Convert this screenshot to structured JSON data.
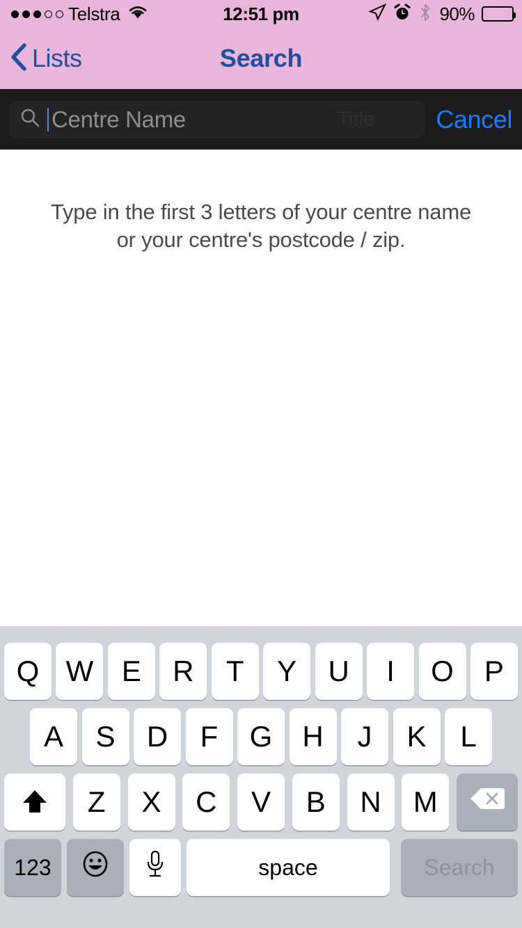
{
  "status_bar": {
    "carrier": "Telstra",
    "signal_dots_filled": 3,
    "signal_dots_total": 5,
    "wifi_icon": "wifi-icon",
    "time": "12:51 pm",
    "location_icon": "location-arrow-icon",
    "alarm_icon": "alarm-clock-icon",
    "bluetooth_icon": "bluetooth-icon",
    "battery_percent": "90%",
    "battery_level": 90
  },
  "nav_bar": {
    "back_label": "Lists",
    "back_icon": "chevron-left-icon",
    "title": "Search",
    "background_color": "#eab5da",
    "tint_color": "#1e4fa0"
  },
  "search_bar": {
    "search_icon": "search-icon",
    "placeholder": "Centre Name",
    "value": "",
    "ghost_text": "Title",
    "cancel_label": "Cancel",
    "cancel_color": "#1a7bff",
    "field_background": "#242424",
    "bar_background": "#1c1c1c"
  },
  "content": {
    "hint_line_1": "Type in the first 3 letters of your centre name",
    "hint_line_2": "or your centre's postcode / zip."
  },
  "keyboard": {
    "background_color": "#d1d5da",
    "row1": [
      "Q",
      "W",
      "E",
      "R",
      "T",
      "Y",
      "U",
      "I",
      "O",
      "P"
    ],
    "row2": [
      "A",
      "S",
      "D",
      "F",
      "G",
      "H",
      "J",
      "K",
      "L"
    ],
    "row3_letters": [
      "Z",
      "X",
      "C",
      "V",
      "B",
      "N",
      "M"
    ],
    "shift_icon": "shift-up-arrow-icon",
    "shift_state": "shifted",
    "delete_icon": "backspace-delete-icon",
    "numbers_label": "123",
    "emoji_icon": "smiley-face-icon",
    "dictation_icon": "microphone-icon",
    "space_label": "space",
    "return_label": "Search"
  }
}
